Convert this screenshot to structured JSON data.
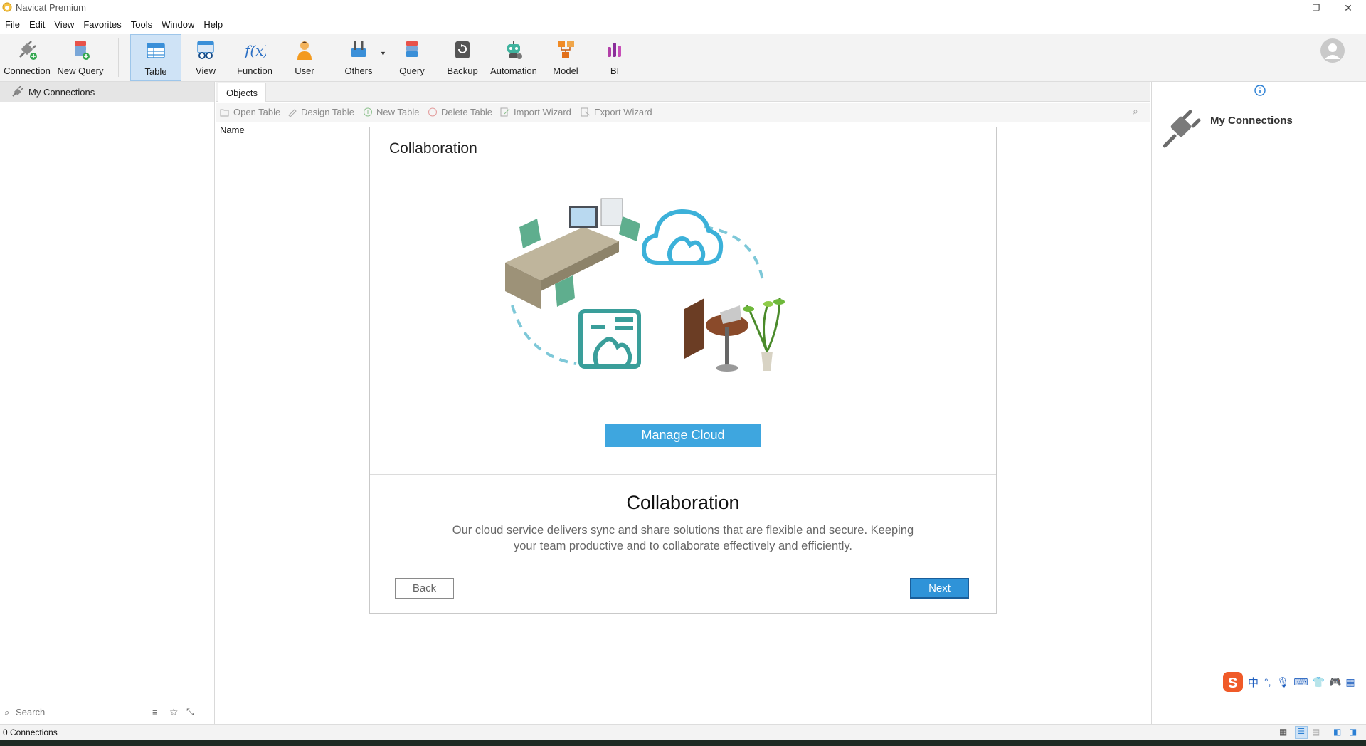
{
  "window": {
    "title": "Navicat Premium",
    "controls": [
      "—",
      "❐",
      "✕"
    ]
  },
  "menu": [
    "File",
    "Edit",
    "View",
    "Favorites",
    "Tools",
    "Window",
    "Help"
  ],
  "toolbar": {
    "buttons": [
      {
        "label": "Connection",
        "icon": "connection-plug-icon"
      },
      {
        "label": "New Query",
        "icon": "new-query-icon"
      },
      {
        "label": "Table",
        "icon": "table-icon"
      },
      {
        "label": "View",
        "icon": "view-glasses-icon"
      },
      {
        "label": "Function",
        "icon": "function-fx-icon"
      },
      {
        "label": "User",
        "icon": "user-icon"
      },
      {
        "label": "Others",
        "icon": "others-tools-icon"
      },
      {
        "label": "Query",
        "icon": "query-icon"
      },
      {
        "label": "Backup",
        "icon": "backup-icon"
      },
      {
        "label": "Automation",
        "icon": "automation-robot-icon"
      },
      {
        "label": "Model",
        "icon": "model-icon"
      },
      {
        "label": "BI",
        "icon": "bi-chart-icon"
      }
    ],
    "active": "Table"
  },
  "left_panel": {
    "item": "My Connections",
    "search_placeholder": "Search"
  },
  "tabs": [
    "Objects"
  ],
  "object_toolbar": {
    "open_table": "Open Table",
    "design_table": "Design Table",
    "new_table": "New Table",
    "delete_table": "Delete Table",
    "import_wizard": "Import Wizard",
    "export_wizard": "Export Wizard"
  },
  "columns": {
    "name": "Name"
  },
  "right_panel": {
    "title": "My Connections",
    "info_icon": "info-icon"
  },
  "status": {
    "connections": "0 Connections"
  },
  "dialog": {
    "header": "Collaboration",
    "manage_button": "Manage Cloud",
    "title": "Collaboration",
    "description": "Our cloud service delivers sync and share solutions that are flexible and secure. Keeping your team productive and to collaborate effectively and efficiently.",
    "back": "Back",
    "next": "Next"
  },
  "ime": {
    "lang": "中"
  },
  "colors": {
    "accent": "#3ea6df",
    "next_button": "#2f93d8",
    "teal": "#3a9e9a"
  }
}
